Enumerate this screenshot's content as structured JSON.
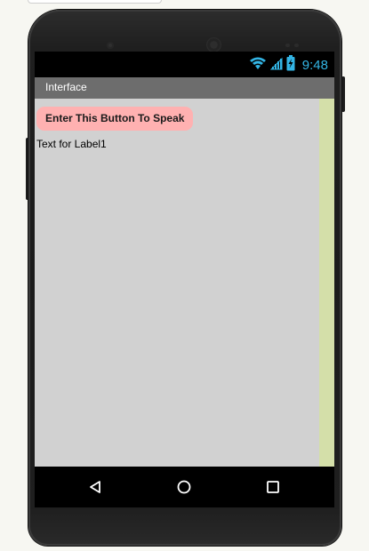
{
  "status_bar": {
    "time": "9:48",
    "accent_color": "#33b5e5",
    "icons": [
      "wifi-icon",
      "signal-icon",
      "battery-charging-icon"
    ]
  },
  "app": {
    "title": "Interface"
  },
  "content": {
    "button_label": "Enter This Button To Speak",
    "label1_text": "Text for Label1",
    "colors": {
      "button_bg": "#ffb1b1",
      "screen_bg": "#d1d1d1",
      "right_strip": "#d4dfa9",
      "title_bar": "#6d6d6d"
    }
  },
  "nav_bar": {
    "buttons": [
      "back-icon",
      "home-icon",
      "recents-icon"
    ]
  }
}
